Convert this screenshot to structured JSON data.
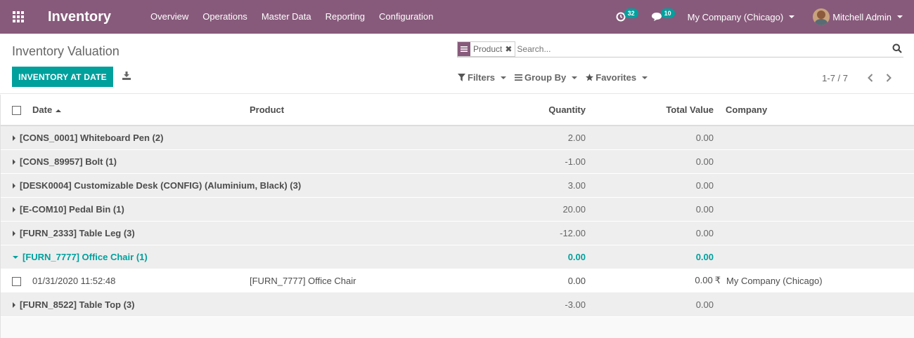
{
  "navbar": {
    "app_title": "Inventory",
    "menu": [
      "Overview",
      "Operations",
      "Master Data",
      "Reporting",
      "Configuration"
    ],
    "activity_count": "32",
    "message_count": "10",
    "company": "My Company (Chicago)",
    "user": "Mitchell Admin"
  },
  "control_panel": {
    "breadcrumb": "Inventory Valuation",
    "primary_button": "INVENTORY AT DATE",
    "search": {
      "facet_value": "Product",
      "remove_symbol": "✖",
      "placeholder": "Search..."
    },
    "filters": "Filters",
    "group_by": "Group By",
    "favorites": "Favorites",
    "pager": "1-7 / 7"
  },
  "table": {
    "headers": {
      "date": "Date",
      "product": "Product",
      "quantity": "Quantity",
      "total_value": "Total Value",
      "company": "Company"
    },
    "groups": [
      {
        "label": "[CONS_0001] Whiteboard Pen (2)",
        "quantity": "2.00",
        "value": "0.00"
      },
      {
        "label": "[CONS_89957] Bolt (1)",
        "quantity": "-1.00",
        "value": "0.00"
      },
      {
        "label": "[DESK0004] Customizable Desk (CONFIG) (Aluminium, Black) (3)",
        "quantity": "3.00",
        "value": "0.00"
      },
      {
        "label": "[E-COM10] Pedal Bin (1)",
        "quantity": "20.00",
        "value": "0.00"
      },
      {
        "label": "[FURN_2333] Table Leg (3)",
        "quantity": "-12.00",
        "value": "0.00"
      },
      {
        "label": "[FURN_7777] Office Chair (1)",
        "quantity": "0.00",
        "value": "0.00"
      },
      {
        "label": "[FURN_8522] Table Top (3)",
        "quantity": "-3.00",
        "value": "0.00"
      }
    ],
    "expanded_record": {
      "date": "01/31/2020 11:52:48",
      "product": "[FURN_7777] Office Chair",
      "quantity": "0.00",
      "value": "0.00",
      "currency": "₹",
      "company": "My Company (Chicago)"
    }
  },
  "colors": {
    "brand": "#875a7b",
    "accent": "#00a09d"
  },
  "icons": {
    "apps": "apps-grid-icon",
    "activity": "clock-icon",
    "messages": "chat-icon",
    "download": "download-icon",
    "facet": "list-icon",
    "search": "search-icon",
    "filter": "funnel-icon",
    "group": "bars-icon",
    "favorite": "star-icon",
    "prev": "chevron-left-icon",
    "next": "chevron-right-icon"
  }
}
